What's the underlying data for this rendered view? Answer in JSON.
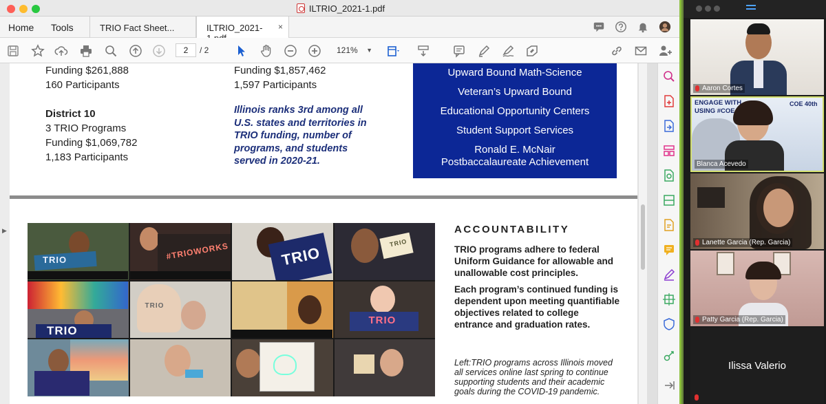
{
  "window": {
    "title": "ILTRIO_2021-1.pdf",
    "traffic_colors": [
      "#fe5f57",
      "#febc2e",
      "#28c840"
    ]
  },
  "menu": {
    "home": "Home",
    "tools": "Tools",
    "tabs": [
      {
        "label": "TRIO Fact Sheet..."
      },
      {
        "label": "ILTRIO_2021-1.pdf",
        "close": "×"
      }
    ]
  },
  "toolbar": {
    "page_current": "2",
    "page_total": "/ 2",
    "zoom": "121%",
    "icons": [
      "save-icon",
      "bookmark-star-icon",
      "upload-cloud-icon",
      "print-icon",
      "search-zoom-icon",
      "page-up-icon",
      "page-down-icon",
      "select-arrow-icon",
      "hand-icon",
      "zoom-out-icon",
      "zoom-in-icon",
      "page-fit-icon",
      "scroll-mode-icon",
      "comment-icon",
      "highlight-pen-icon",
      "sign-icon",
      "fill-sign-icon",
      "link-icon",
      "mail-icon",
      "add-user-icon"
    ]
  },
  "document": {
    "left_col": {
      "funding_top": "Funding $261,888",
      "participants_top": "160 Participants",
      "district_heading": "District 10",
      "programs": "3 TRIO Programs",
      "funding": "Funding $1,069,782",
      "participants": "1,183 Participants"
    },
    "mid_col": {
      "funding_top": "Funding $1,857,462",
      "participants_top": "1,597 Participants",
      "highlight": "Illinois ranks 3rd among all U.S. states and territories in TRIO funding, number of programs, and students served in 2020-21."
    },
    "programs_box": {
      "items": [
        "Upward Bound Math-Science",
        "Veteran’s Upward Bound",
        "Educational Opportunity Centers",
        "Student Support Services"
      ],
      "last_line1": "Ronald E. McNair",
      "last_line2": "Postbaccalaureate Achievement",
      "color": "#0c2796"
    },
    "photos": {
      "banner_texts": [
        "TRIO",
        "#TRIOWORKS",
        "TRIO",
        "TRIO",
        "TRIO",
        "TRIO",
        "TRIO"
      ]
    },
    "accountability": {
      "title": "ACCOUNTABILITY",
      "p1": "TRIO programs adhere to federal Uniform Guidance for allowable and unallowable cost principles.",
      "p2": "Each program’s continued funding is dependent upon meeting quantifiable objectives related to college entrance and graduation rates.",
      "caption": "Left:TRIO programs across Illinois moved all services online last spring to continue supporting students and their academic goals during the COVID-19 pandemic."
    }
  },
  "rail": {
    "icons": [
      "search-page-icon",
      "create-pdf-icon",
      "export-pdf-icon",
      "organize-pages-icon",
      "edit-pdf-icon",
      "scan-icon",
      "comment-tool-icon",
      "chat-bubble-icon",
      "fill-sign-tool-icon",
      "print-production-icon",
      "protect-icon",
      "more-tools-icon",
      "collapse-rail-icon"
    ]
  },
  "video": {
    "participants": [
      {
        "name": "Aaron Cortes"
      },
      {
        "name": "Blanca Acevedo",
        "banner1": "ENGAGE WITH",
        "banner2": "USING #COE",
        "badge": "COE 40th"
      },
      {
        "name": "Lanette Garcia (Rep. Garcia)"
      },
      {
        "name": "Patty Garcia (Rep. Garcia)"
      },
      {
        "name": "Ilissa Valerio"
      }
    ]
  }
}
